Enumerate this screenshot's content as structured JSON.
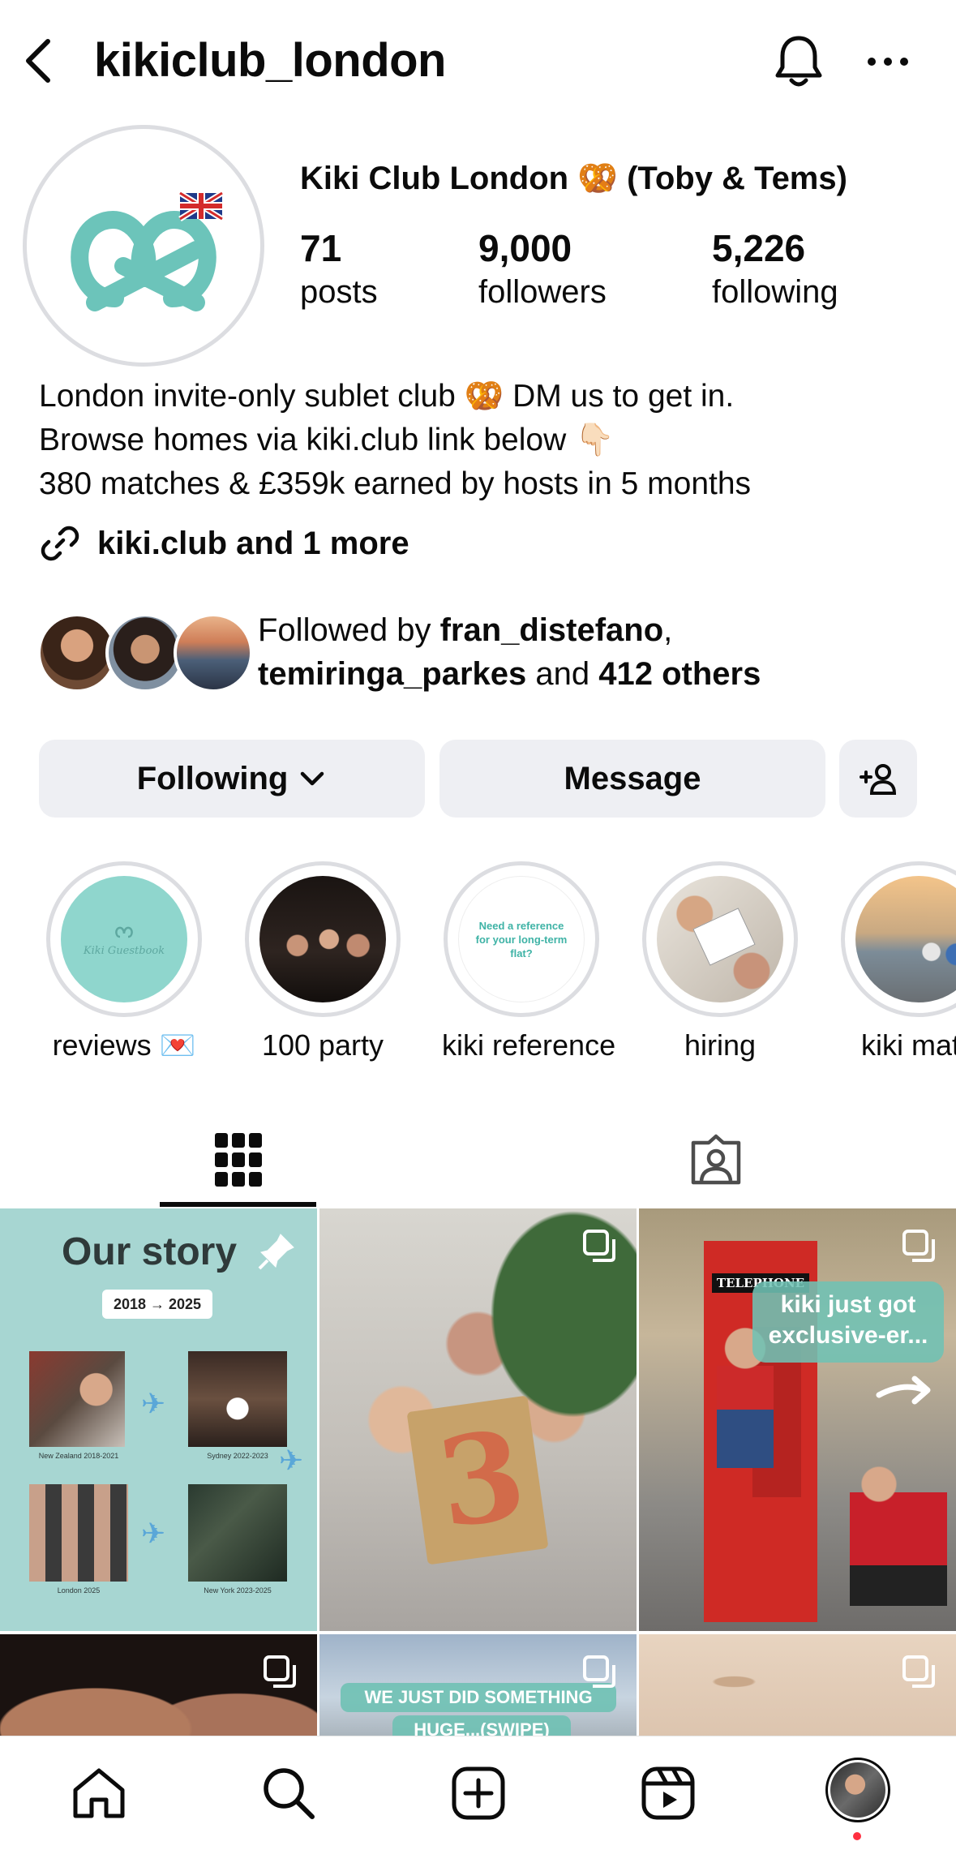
{
  "header": {
    "username": "kikiclub_london"
  },
  "profile": {
    "display_name": "Kiki Club London 🥨 (Toby & Tems)",
    "stats": {
      "posts": {
        "value": "71",
        "label": "posts"
      },
      "followers": {
        "value": "9,000",
        "label": "followers"
      },
      "following": {
        "value": "5,226",
        "label": "following"
      }
    },
    "bio": {
      "line1": "London invite-only sublet club 🥨 DM us to get in.",
      "line2": "Browse homes via kiki.club link below 👇🏻",
      "line3": "380 matches & £359k earned by hosts in 5 months"
    },
    "link_text": "kiki.club and 1 more",
    "followed_by": {
      "prefix": "Followed by ",
      "user1": "fran_distefano",
      "comma": ",",
      "user2": "temiringa_parkes",
      "and": " and ",
      "others": "412 others"
    }
  },
  "buttons": {
    "following_label": "Following",
    "message_label": "Message"
  },
  "highlights": [
    {
      "label": "reviews 💌",
      "inner_text": "Kiki Guestbook"
    },
    {
      "label": "100 party"
    },
    {
      "label": "kiki reference",
      "inner_text": "Need a reference for your long-term flat?"
    },
    {
      "label": "hiring"
    },
    {
      "label": "kiki math"
    }
  ],
  "grid": {
    "post1": {
      "title": "Our story",
      "years": "2018 → 2025",
      "captions": [
        "New Zealand 2018-2021",
        "Sydney 2022-2023",
        "London 2025",
        "New York 2023-2025"
      ]
    },
    "post3": {
      "sign": "TELEPHONE",
      "overlay": "kiki just got exclusive-er..."
    },
    "post5": {
      "overlay_line1": "WE JUST DID SOMETHING",
      "overlay_line2": "HUGE...(SWIPE)"
    }
  },
  "colors": {
    "brand_teal": "#6cc4ba",
    "grid_teal_bg": "#a7d6d2",
    "button_bg": "#eeeff3",
    "ring_gray": "#dcdde1",
    "notification_dot": "#ff3040"
  }
}
